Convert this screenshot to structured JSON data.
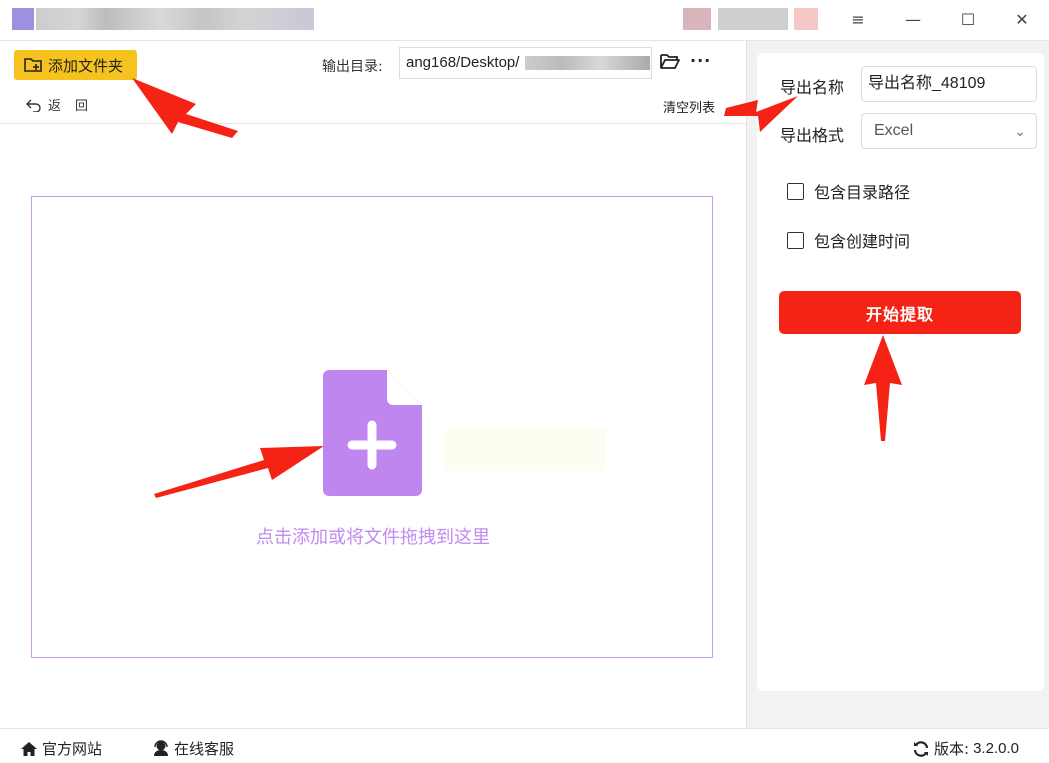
{
  "titlebar": {
    "controls": {
      "menu": "≡",
      "minimize": "—",
      "maximize": "☐",
      "close": "✕"
    }
  },
  "toolbar": {
    "add_folder_label": "添加文件夹",
    "back_label": "返回",
    "output_dir_label": "输出目录:",
    "output_dir_value": "ang168/Desktop/",
    "more_label": "···",
    "clear_list_label": "清空列表"
  },
  "dropzone": {
    "hint": "点击添加或将文件拖拽到这里",
    "accent_color": "#c28bf0"
  },
  "settings": {
    "export_name_label": "导出名称",
    "export_name_value": "导出名称_48109",
    "export_format_label": "导出格式",
    "export_format_value": "Excel",
    "include_dir_path_label": "包含目录路径",
    "include_dir_path_checked": false,
    "include_create_time_label": "包含创建时间",
    "include_create_time_checked": false,
    "start_button_label": "开始提取",
    "start_button_color": "#f52316"
  },
  "statusbar": {
    "official_site_label": "官方网站",
    "online_support_label": "在线客服",
    "version_label": "版本:",
    "version_value": "3.2.0.0"
  },
  "icons": {
    "add_folder": "folder-plus-icon",
    "back": "back-arrow-icon",
    "open_folder": "folder-open-icon",
    "file_add": "file-plus-icon",
    "home": "home-icon",
    "support": "headset-icon",
    "refresh": "refresh-icon"
  }
}
